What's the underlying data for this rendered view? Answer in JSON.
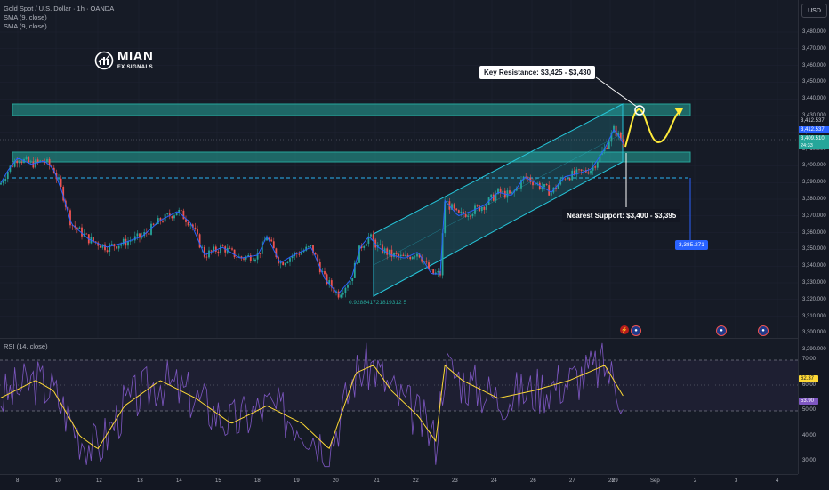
{
  "legend": {
    "symbol": "Gold Spot / U.S. Dollar · 1h · OANDA",
    "sma1": "SMA (9, close)",
    "sma2": "SMA (9, close)"
  },
  "rsi_legend": "RSI (14, close)",
  "logo": {
    "main": "MIAN",
    "sub": "FX SIGNALS"
  },
  "currency": "USD",
  "price_ticks": [
    "3,480.000",
    "3,470.000",
    "3,460.000",
    "3,450.000",
    "3,440.000",
    "3,430.000",
    "3,420.000",
    "3,410.000",
    "3,400.000",
    "3,390.000",
    "3,380.000",
    "3,370.000",
    "3,360.000",
    "3,350.000",
    "3,340.000",
    "3,330.000",
    "3,320.000",
    "3,310.000",
    "3,300.000",
    "3,290.000"
  ],
  "rsi_ticks": [
    "70.00",
    "60.00",
    "50.00",
    "40.00",
    "30.00"
  ],
  "time_ticks": [
    "8",
    "10",
    "12",
    "13",
    "14",
    "15",
    "18",
    "19",
    "20",
    "21",
    "22",
    "23",
    "24",
    "26",
    "27",
    "28",
    "29",
    "Sep",
    "2",
    "3",
    "4"
  ],
  "price_tags": {
    "tag1": "3,412.537",
    "tag2": "3,412.537",
    "tag3": "3,409.510",
    "countdown": "24:33"
  },
  "rsi_tags": {
    "sma": "62.37",
    "rsi": "53.90"
  },
  "annotations": {
    "resistance": "Key Resistance: $3,425 - $3,430",
    "support": "Nearest Support: $3,400 - $3,395",
    "target": "3,385.271",
    "fib": "0.928841721819312 5"
  },
  "colors": {
    "background": "#161b26",
    "zone": "#26a69a",
    "channel": "#26c6da",
    "bull": "#26a69a",
    "bear": "#ef5350",
    "sma": "#2962ff",
    "rsi": "#7e57c2",
    "rsi_sma": "#fdd835",
    "forecast": "#ffeb3b"
  }
}
